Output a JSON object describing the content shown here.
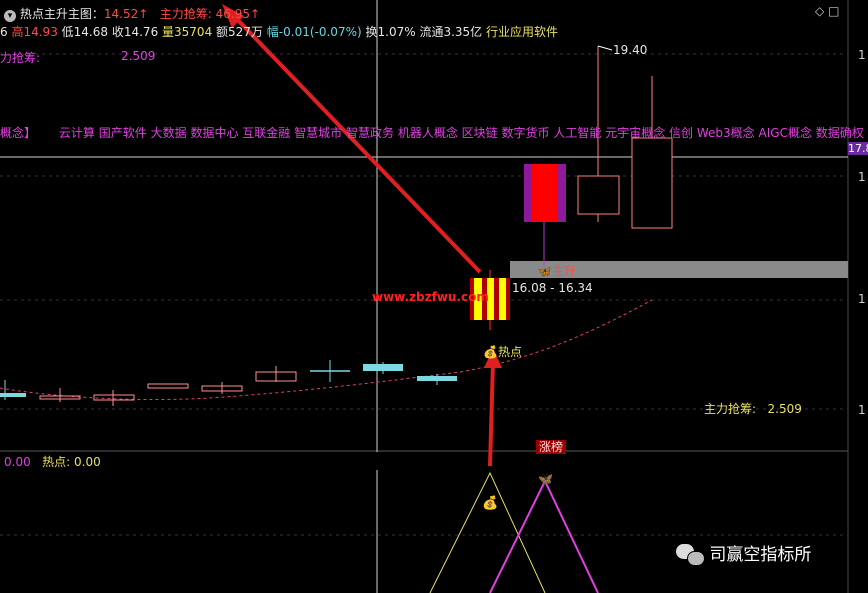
{
  "header": {
    "title": "热点主升主图",
    "title_value": "14.52",
    "indicator_label": "主力抢筹:",
    "indicator_value": "46.95",
    "arrow": "↑",
    "window_icons": [
      "◇",
      "□"
    ]
  },
  "quote": {
    "lead": "6",
    "high": "高14.93",
    "low": "低14.68",
    "close": "收14.76",
    "volume": "量35704",
    "amount": "额527",
    "amount_suffix": "万",
    "change": "幅-0.01(-0.07%)",
    "turnover": "换1.07%",
    "float_cap": "流通3.35亿",
    "industry": "行业应用软件"
  },
  "left_label": {
    "text": "力抢筹:",
    "value": "2.509"
  },
  "concepts_prefix": "概念】",
  "concepts": [
    "云计算",
    "国产软件",
    "大数据",
    "数据中心",
    "互联金融",
    "智慧城市",
    "智慧政务",
    "机器人概念",
    "区块链",
    "数字货币",
    "人工智能",
    "元宇宙概念",
    "信创",
    "Web3概念",
    "AIGC概念",
    "数据确权"
  ],
  "price_labels": {
    "peak": "19.40",
    "range": "16.08 - 16.34",
    "right_edge": "17.8",
    "axis_1": "1",
    "axis_2": "1",
    "axis_3": "1",
    "axis_4": "1"
  },
  "signals": {
    "zhusheng": "主升",
    "redian": "热点",
    "zhangbang": "涨榜"
  },
  "watermark": "www.zbzfwu.com",
  "bottom_right_label": {
    "text": "主力抢筹:",
    "value": "2.509"
  },
  "sub_panel": {
    "left_value": "0.00",
    "label": "热点:",
    "value": "0.00"
  },
  "brand": {
    "icon": "wechat-icon",
    "text": "司赢空指标所"
  },
  "colors": {
    "up": "#ff3030",
    "down": "#7ed8e0",
    "accent_magenta": "#e040e0",
    "accent_yellow": "#e8e060",
    "arrow_red": "#e02020"
  }
}
